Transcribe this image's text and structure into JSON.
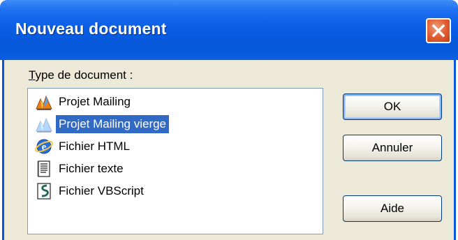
{
  "dialog": {
    "title": "Nouveau document",
    "doc_type_label_mnemonic": "T",
    "doc_type_label_rest": "ype de document :",
    "items": [
      {
        "label": "Projet Mailing",
        "icon": "mailing-project-icon",
        "selected": false
      },
      {
        "label": "Projet Mailing vierge",
        "icon": "blank-mailing-project-icon",
        "selected": true
      },
      {
        "label": "Fichier HTML",
        "icon": "html-file-icon",
        "selected": false
      },
      {
        "label": "Fichier texte",
        "icon": "text-file-icon",
        "selected": false
      },
      {
        "label": "Fichier VBScript",
        "icon": "vbscript-file-icon",
        "selected": false
      }
    ],
    "buttons": {
      "ok": "OK",
      "cancel": "Annuler",
      "help": "Aide"
    }
  },
  "colors": {
    "titlebar": "#0a5fe6",
    "selection": "#316ac5",
    "dialog_face": "#ece9d8"
  }
}
